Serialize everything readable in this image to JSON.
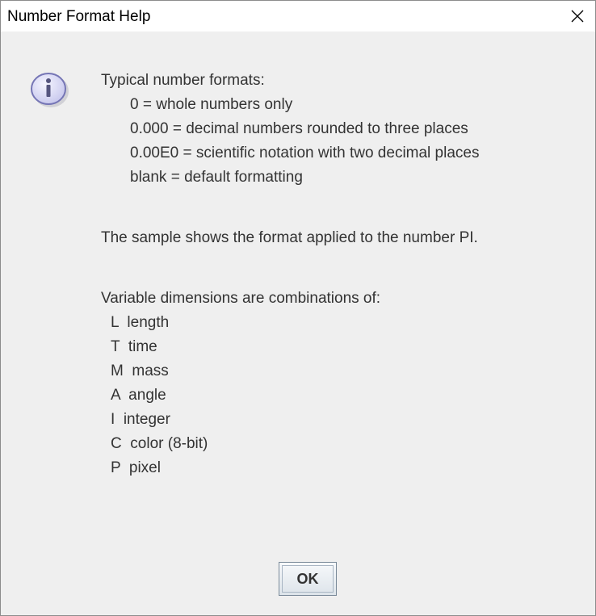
{
  "window": {
    "title": "Number Format Help",
    "close_icon": "close-icon"
  },
  "message": {
    "icon": "info-icon",
    "intro": "Typical number formats:",
    "formats": [
      "0 = whole numbers only",
      "0.000 = decimal numbers rounded to three places",
      "0.00E0 = scientific notation with two decimal places",
      "blank = default formatting"
    ],
    "sample_note": "The sample shows the format applied to the number PI.",
    "dimensions_intro": "Variable dimensions are combinations of:",
    "dimensions": [
      "L  length",
      "T  time",
      "M  mass",
      "A  angle",
      "I  integer",
      "C  color (8-bit)",
      "P  pixel"
    ]
  },
  "buttons": {
    "ok_label": "OK"
  }
}
